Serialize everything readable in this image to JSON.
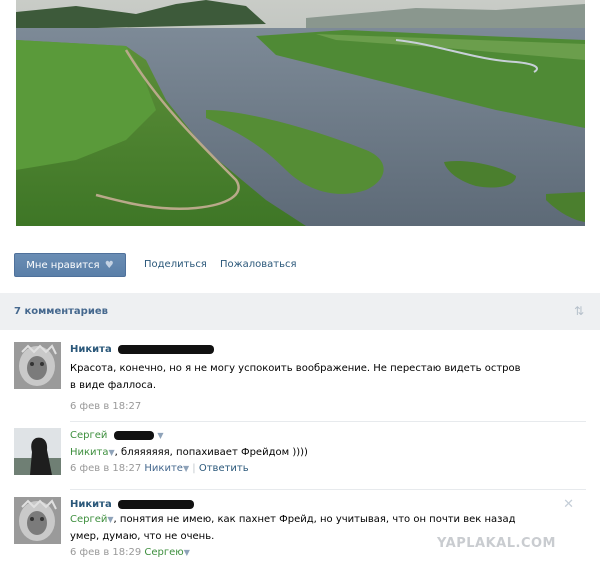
{
  "post": {
    "photo_icon": "landscape-photo",
    "like_label": "Мне нравится",
    "share_label": "Поделиться",
    "report_label": "Пожаловаться"
  },
  "comments_header": {
    "title": "7 комментариев",
    "sort_icon": "sort-arrows-icon"
  },
  "comments": [
    {
      "author": "Никита",
      "text": "Красота, конечно, но я не могу успокоить воображение. Не перестаю видеть остров в виде фаллоса.",
      "time": "6 фев в 18:27"
    },
    {
      "author": "Сергей",
      "reply_name": "Никита",
      "text": ", бляяяяяя, попахивает Фрейдом ))))",
      "time": "6 фев в 18:27",
      "reply_to": "Никите",
      "reply_label": "Ответить"
    },
    {
      "author": "Никита",
      "reply_name": "Сергей",
      "text": ", понятия не имею, как пахнет Фрейд, но учитывая, что он почти век назад умер, думаю, что не очень.",
      "time": "6 фев в 18:29",
      "reply_to": "Сергею"
    }
  ],
  "watermark": "YAPLAKAL.COM",
  "colors": {
    "link": "#2b587a",
    "button": "#5a7fa8",
    "header_bg": "#eef0f2",
    "green_name": "#3e8f3e"
  }
}
